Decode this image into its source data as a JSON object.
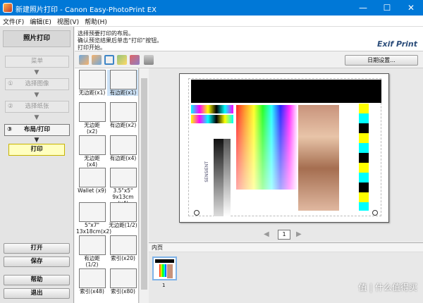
{
  "window": {
    "title": "新建照片打印 - Canon Easy-PhotoPrint EX",
    "minimize": "—",
    "maximize": "☐",
    "close": "✕"
  },
  "menu": [
    "文件(F)",
    "编辑(E)",
    "视图(V)",
    "帮助(H)"
  ],
  "left": {
    "title": "照片打印",
    "steps": [
      {
        "num": "",
        "label": "菜单"
      },
      {
        "num": "①",
        "label": "选择图像"
      },
      {
        "num": "②",
        "label": "选择纸张"
      },
      {
        "num": "③",
        "label": "布局/打印"
      }
    ],
    "print": "打印",
    "open": "打开",
    "save": "保存",
    "help": "帮助",
    "exit": "退出"
  },
  "instructions": [
    "选择预要打印的布局。",
    "确认预览结果后单击“打印”按钮。",
    "打印开始。"
  ],
  "logo": "Exif Print",
  "toolbar": {
    "date_settings": "日期设置..."
  },
  "layouts": [
    {
      "label": "无边距(x1)",
      "selected": false
    },
    {
      "label": "有边距(x1)",
      "selected": true
    },
    {
      "label": "无边距\n(x2)",
      "selected": false
    },
    {
      "label": "有边距(x2)",
      "selected": false
    },
    {
      "label": "无边距\n(x4)",
      "selected": false
    },
    {
      "label": "有边距(x4)",
      "selected": false
    },
    {
      "label": "Wallet (x9)",
      "selected": false
    },
    {
      "label": "3.5\"x5\"\n9x13cm (x4)",
      "selected": false
    },
    {
      "label": "5\"x7\"\n13x18cm(x2)",
      "selected": false
    },
    {
      "label": "无边距(1/2)",
      "selected": false
    },
    {
      "label": "有边距\n(1/2)",
      "selected": false
    },
    {
      "label": "索引(x20)",
      "selected": false
    },
    {
      "label": "索引(x48)",
      "selected": false
    },
    {
      "label": "索引(x80)",
      "selected": false
    }
  ],
  "preview": {
    "page_number": "1",
    "side_text": "SENSIENT"
  },
  "pages": {
    "label": "内页",
    "thumb_number": "1"
  },
  "watermark": "值 | 什么值得买",
  "colors": {
    "titlebar": "#0078d7",
    "selected": "#cde3f8",
    "print_button": "#ffffc0"
  }
}
